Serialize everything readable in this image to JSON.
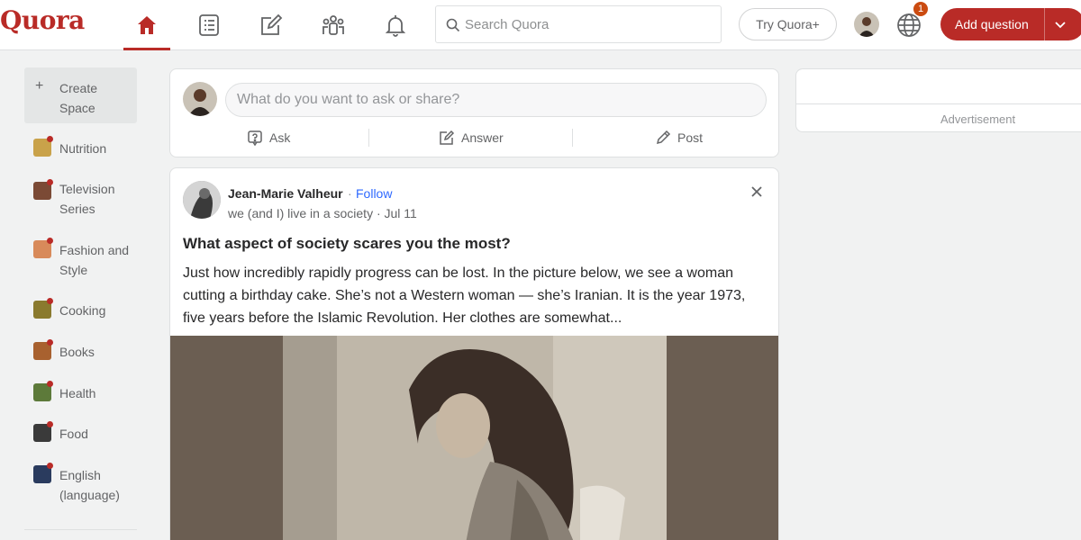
{
  "header": {
    "logo": "Quora",
    "nav_icons": [
      "home-icon",
      "following-icon",
      "answer-icon",
      "spaces-icon",
      "notifications-icon"
    ],
    "search_placeholder": "Search Quora",
    "try_plus_label": "Try Quora+",
    "notification_count": "1",
    "add_question_label": "Add question",
    "brand_color": "#b92b27"
  },
  "sidebar": {
    "create_label": "Create Space",
    "items": [
      {
        "label": "Nutrition",
        "color": "#c9a24a"
      },
      {
        "label": "Television Series",
        "color": "#7b4a35"
      },
      {
        "label": "Fashion and Style",
        "color": "#d88a5a"
      },
      {
        "label": "Cooking",
        "color": "#8a7a2e"
      },
      {
        "label": "Books",
        "color": "#a8612f"
      },
      {
        "label": "Health",
        "color": "#5d7a3a"
      },
      {
        "label": "Food",
        "color": "#3a3a3a"
      },
      {
        "label": "English (language)",
        "color": "#2a3b5e"
      }
    ]
  },
  "ask_box": {
    "placeholder": "What do you want to ask or share?",
    "actions": [
      {
        "label": "Ask",
        "icon": "ask-icon"
      },
      {
        "label": "Answer",
        "icon": "answer-icon"
      },
      {
        "label": "Post",
        "icon": "post-icon"
      }
    ]
  },
  "post": {
    "author": "Jean-Marie Valheur",
    "follow_label": "Follow",
    "credential": "we (and I) live in a society · Jul 11",
    "question": "What aspect of society scares you the most?",
    "body": "Just how incredibly rapidly progress can be lost. In the picture below, we see a woman cutting a birthday cake. She’s not a Western woman — she’s Iranian. It is the year 1973, five years before the Islamic Revolution. Her clothes are somewhat..."
  },
  "ad": {
    "label": "Advertisement"
  }
}
